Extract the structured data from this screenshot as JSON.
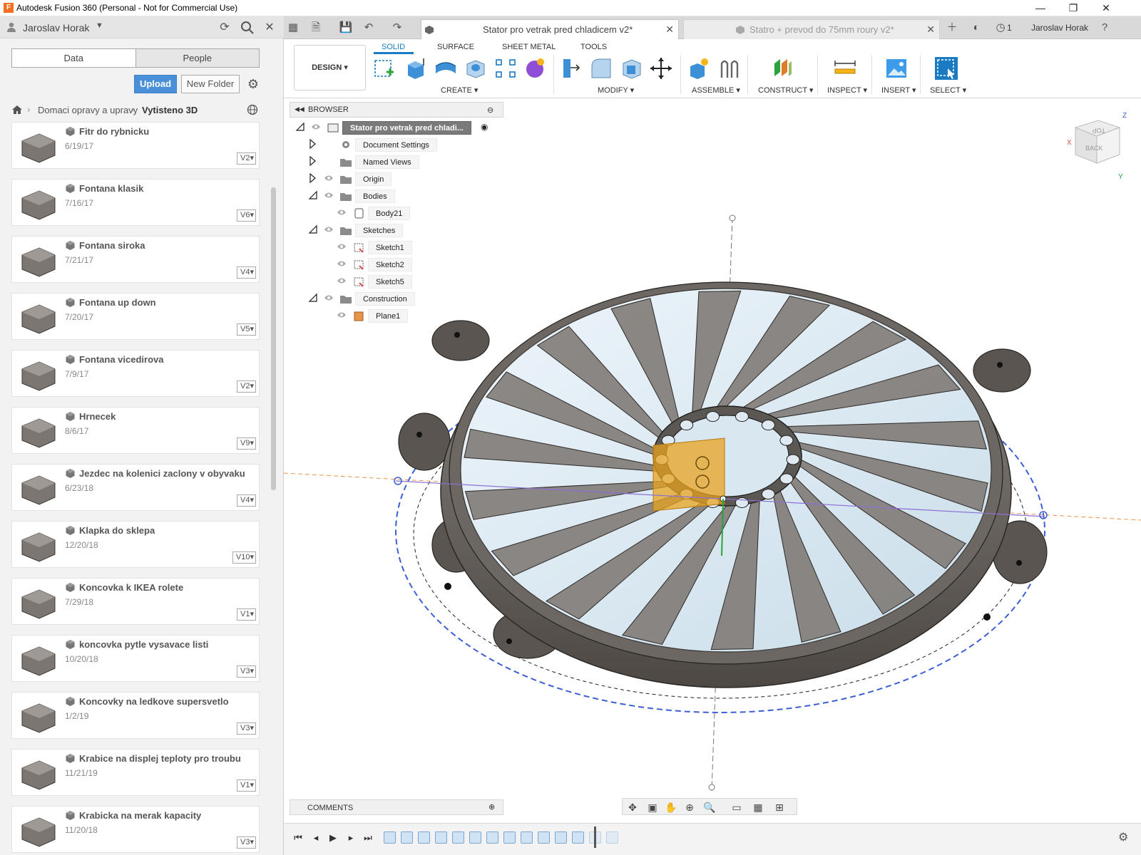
{
  "window": {
    "title": "Autodesk Fusion 360 (Personal - Not for Commercial Use)",
    "minimize_glyph": "—",
    "maximize_glyph": "❐",
    "close_glyph": "✕"
  },
  "data_panel": {
    "user_name": "Jaroslav Horak",
    "tabs": [
      "Data",
      "People"
    ],
    "upload_label": "Upload",
    "new_folder_label": "New Folder",
    "breadcrumb": [
      "Domaci opravy a upravy",
      "Vytisteno 3D"
    ],
    "files": [
      {
        "name": "Fitr do rybnicku",
        "date": "6/19/17",
        "version": "V2"
      },
      {
        "name": "Fontana klasik",
        "date": "7/16/17",
        "version": "V6"
      },
      {
        "name": "Fontana siroka",
        "date": "7/21/17",
        "version": "V4"
      },
      {
        "name": "Fontana up down",
        "date": "7/20/17",
        "version": "V5"
      },
      {
        "name": "Fontana vicedirova",
        "date": "7/9/17",
        "version": "V2"
      },
      {
        "name": "Hrnecek",
        "date": "8/6/17",
        "version": "V9"
      },
      {
        "name": "Jezdec na kolenici zaclony v obyvaku",
        "date": "6/23/18",
        "version": "V4"
      },
      {
        "name": "Klapka do sklepa",
        "date": "12/20/18",
        "version": "V10"
      },
      {
        "name": "Koncovka k IKEA rolete",
        "date": "7/29/18",
        "version": "V1"
      },
      {
        "name": "koncovka pytle vysavace listi",
        "date": "10/20/18",
        "version": "V3"
      },
      {
        "name": "Koncovky na ledkove supersvetlo",
        "date": "1/2/19",
        "version": "V3"
      },
      {
        "name": "Krabice na displej teploty pro troubu",
        "date": "11/21/19",
        "version": "V1"
      },
      {
        "name": "Krabicka na merak kapacity",
        "date": "11/20/18",
        "version": "V3"
      }
    ]
  },
  "tabs": {
    "active": "Stator pro vetrak pred chladicem v2*",
    "inactive": "Statro + prevod do 75mm roury v2*",
    "account_name": "Jaroslav Horak",
    "job_count": "1"
  },
  "ribbon": {
    "workspace": "DESIGN",
    "tabs": [
      "SOLID",
      "SURFACE",
      "SHEET METAL",
      "TOOLS"
    ],
    "groups": [
      "CREATE",
      "MODIFY",
      "ASSEMBLE",
      "CONSTRUCT",
      "INSPECT",
      "INSERT",
      "SELECT"
    ]
  },
  "browser": {
    "title": "BROWSER",
    "root": "Stator pro vetrak pred chladi...",
    "nodes": {
      "document_settings": "Document Settings",
      "named_views": "Named Views",
      "origin": "Origin",
      "bodies": "Bodies",
      "body21": "Body21",
      "sketches": "Sketches",
      "sketch1": "Sketch1",
      "sketch2": "Sketch2",
      "sketch5": "Sketch5",
      "construction": "Construction",
      "plane1": "Plane1"
    }
  },
  "viewcube": {
    "top": "TOP",
    "back": "BACK",
    "axis_z": "Z",
    "axis_x": "X",
    "axis_y": "Y"
  },
  "comments_label": "COMMENTS",
  "colors": {
    "accent": "#1a7ac2",
    "upload": "#4a90d9",
    "model": "#6b6560"
  }
}
